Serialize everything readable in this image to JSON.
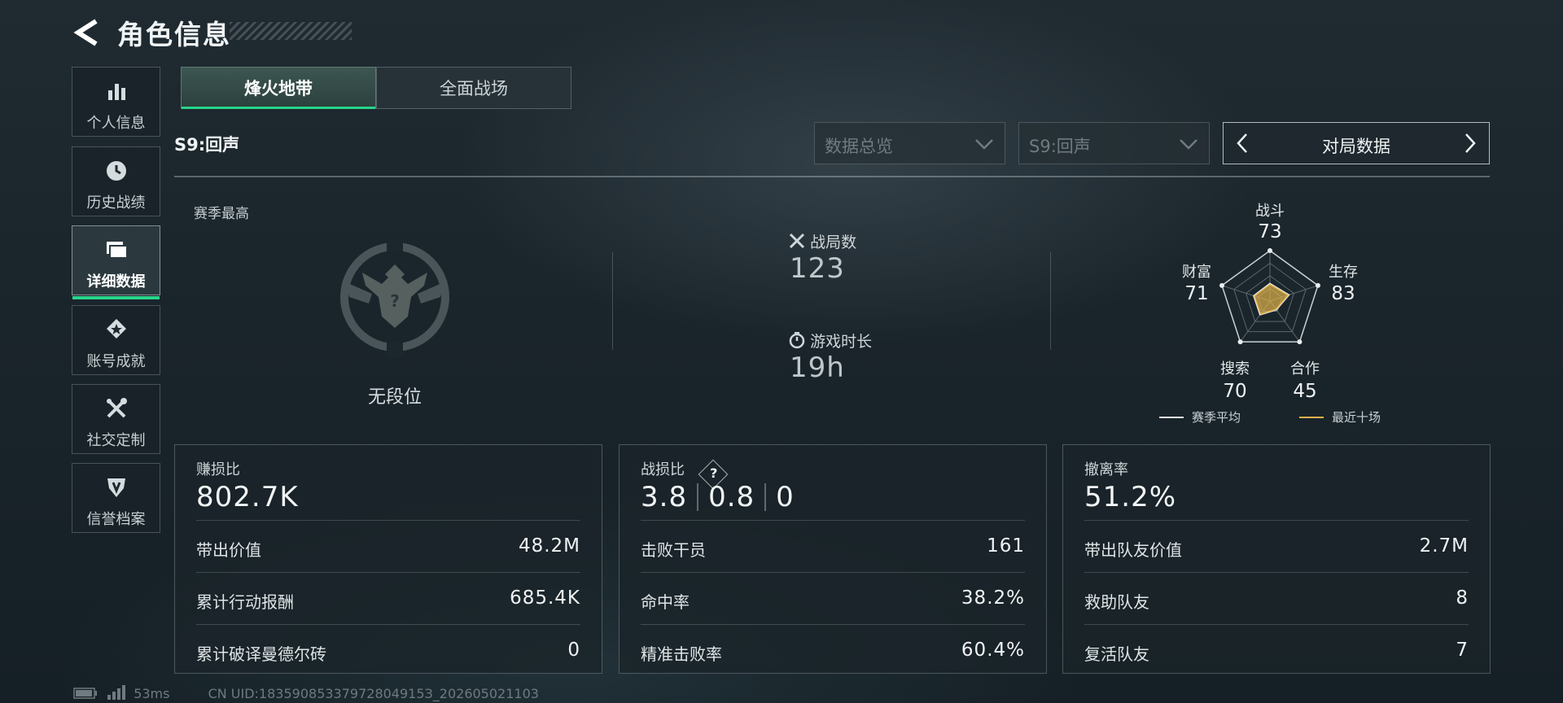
{
  "header": {
    "title": "角色信息"
  },
  "nav": {
    "items": [
      {
        "label": "个人信息",
        "icon": "bar-chart-icon",
        "active": false
      },
      {
        "label": "历史战绩",
        "icon": "clock-icon",
        "active": false
      },
      {
        "label": "详细数据",
        "icon": "folder-icon",
        "active": true
      },
      {
        "label": "账号成就",
        "icon": "achievement-icon",
        "active": false
      },
      {
        "label": "社交定制",
        "icon": "tools-icon",
        "active": false
      },
      {
        "label": "信誉档案",
        "icon": "shield-icon",
        "active": false
      }
    ]
  },
  "mode_tabs": [
    {
      "label": "烽火地带",
      "active": true
    },
    {
      "label": "全面战场",
      "active": false
    }
  ],
  "season": {
    "label": "S9:回声"
  },
  "filters": {
    "dropdown1": "数据总览",
    "dropdown2": "S9:回声",
    "pager_label": "对局数据"
  },
  "rank": {
    "label": "赛季最高",
    "value": "无段位"
  },
  "summary": {
    "matches_label": "战局数",
    "matches_value": "123",
    "playtime_label": "游戏时长",
    "playtime_value": "19h"
  },
  "radar": {
    "axes": [
      {
        "label": "战斗",
        "value": 73
      },
      {
        "label": "生存",
        "value": 83
      },
      {
        "label": "合作",
        "value": 45
      },
      {
        "label": "搜索",
        "value": 70
      },
      {
        "label": "财富",
        "value": 71
      }
    ],
    "legend": {
      "season_avg": "赛季平均",
      "recent_ten": "最近十场"
    },
    "colors": {
      "season_avg": "#e8ecee",
      "recent_ten": "#e0b24a"
    }
  },
  "cards": {
    "profit": {
      "title": "赚损比",
      "value": "802.7K",
      "rows": [
        {
          "label": "带出价值",
          "value": "48.2M"
        },
        {
          "label": "累计行动报酬",
          "value": "685.4K"
        },
        {
          "label": "累计破译曼德尔砖",
          "value": "0"
        }
      ]
    },
    "kd": {
      "title": "战损比",
      "help": "?",
      "v1": "3.8",
      "v2": "0.8",
      "v3": "0",
      "rows": [
        {
          "label": "击败干员",
          "value": "161"
        },
        {
          "label": "命中率",
          "value": "38.2%"
        },
        {
          "label": "精准击败率",
          "value": "60.4%"
        }
      ]
    },
    "extract": {
      "title": "撤离率",
      "value": "51.2%",
      "rows": [
        {
          "label": "带出队友价值",
          "value": "2.7M"
        },
        {
          "label": "救助队友",
          "value": "8"
        },
        {
          "label": "复活队友",
          "value": "7"
        }
      ]
    }
  },
  "footer": {
    "ping": "53ms",
    "uid": "CN UID:18359085337972804915З_202605021103"
  }
}
